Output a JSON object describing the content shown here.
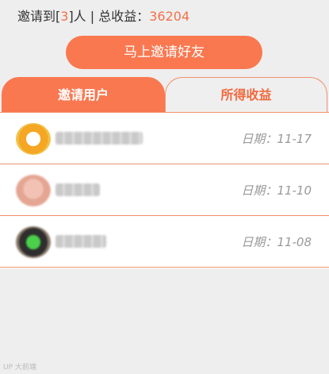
{
  "summary": {
    "invited_prefix": "邀请到[",
    "invited_count": "3",
    "invited_suffix": "]人 | 总收益：",
    "total_earnings": "36204"
  },
  "invite_button": {
    "label": "马上邀请好友"
  },
  "tabs": [
    {
      "label": "邀请用户",
      "active": true
    },
    {
      "label": "所得收益",
      "active": false
    }
  ],
  "invitees": [
    {
      "name": "",
      "date": "日期：11-17"
    },
    {
      "name": "",
      "date": "日期：11-10"
    },
    {
      "name": "",
      "date": "日期：11-08"
    }
  ],
  "watermark": "UP 大前端",
  "colors": {
    "accent": "#f97850",
    "accent_text": "#f06a3f",
    "background": "#eeeeee"
  }
}
